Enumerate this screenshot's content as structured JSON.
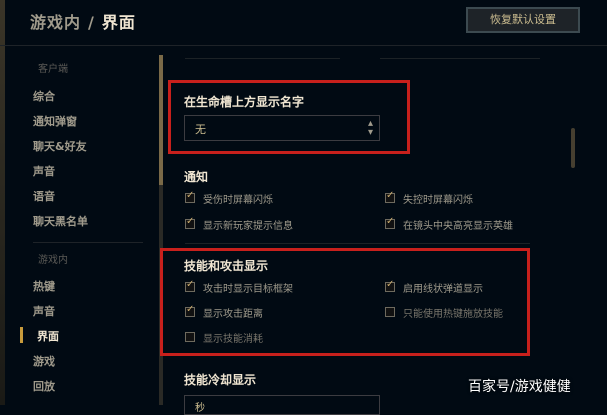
{
  "header": {
    "crumb_parent": "游戏内",
    "crumb_separator": "/",
    "crumb_current": "界面",
    "reset_button": "恢复默认设置"
  },
  "sidebar": {
    "client_section": "客户端",
    "client_items": [
      "综合",
      "通知弹窗",
      "聊天&好友",
      "声音",
      "语音",
      "聊天黑名单"
    ],
    "ingame_section": "游戏内",
    "ingame_items": [
      "热键",
      "声音",
      "界面",
      "游戏",
      "回放"
    ],
    "active_item": "界面"
  },
  "main": {
    "name_above_health": {
      "title": "在生命槽上方显示名字",
      "selected": "无"
    },
    "notifications": {
      "title": "通知",
      "options": [
        {
          "label": "受伤时屏幕闪烁",
          "checked": true
        },
        {
          "label": "失控时屏幕闪烁",
          "checked": true
        },
        {
          "label": "显示新玩家提示信息",
          "checked": true
        },
        {
          "label": "在镜头中央高亮显示英雄",
          "checked": true
        }
      ]
    },
    "ability_display": {
      "title": "技能和攻击显示",
      "options": [
        {
          "label": "攻击时显示目标框架",
          "checked": true
        },
        {
          "label": "启用线状弹道显示",
          "checked": true
        },
        {
          "label": "显示攻击距离",
          "checked": true
        },
        {
          "label": "只能使用热键施放技能",
          "checked": false
        },
        {
          "label": "显示技能消耗",
          "checked": false
        }
      ]
    },
    "cooldown_display": {
      "title": "技能冷却显示",
      "selected": "秒"
    }
  },
  "watermark": "百家号/游戏健健",
  "colors": {
    "background": "#010a13",
    "gold_accent": "#c89b3c",
    "highlight_box": "#c8201c",
    "heading_text": "#f0e6d2"
  }
}
